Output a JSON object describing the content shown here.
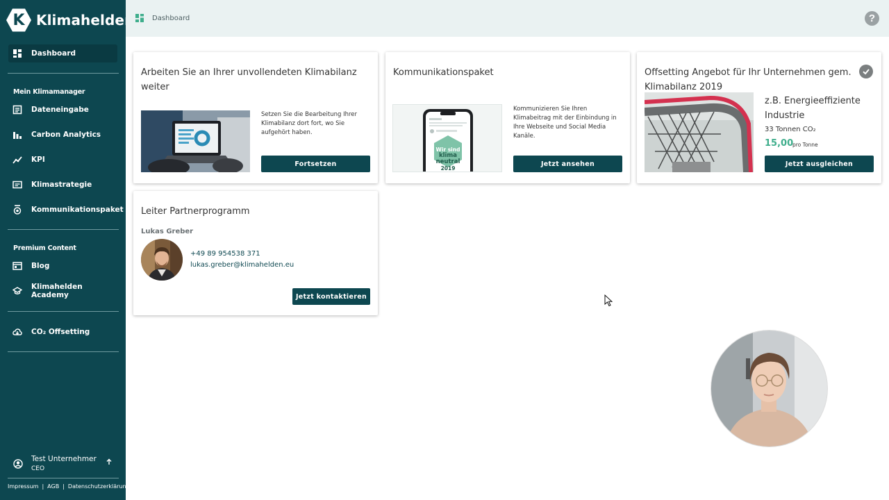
{
  "app": {
    "name": "Klimahelden",
    "logo_letter": "K"
  },
  "sidebar": {
    "active_item": "Dashboard",
    "items_top": [
      {
        "label": "Dashboard",
        "icon": "dashboard-icon"
      }
    ],
    "section1_title": "Mein Klimamanager",
    "section1_items": [
      {
        "label": "Dateneingabe",
        "icon": "data-entry-icon"
      },
      {
        "label": "Carbon Analytics",
        "icon": "bar-chart-icon"
      },
      {
        "label": "KPI",
        "icon": "trend-icon"
      },
      {
        "label": "Klimastrategie",
        "icon": "strategy-icon"
      },
      {
        "label": "Kommunikationspaket",
        "icon": "medal-icon"
      }
    ],
    "section2_title": "Premium Content",
    "section2_items": [
      {
        "label": "Blog",
        "icon": "blog-icon"
      },
      {
        "label": "Klimahelden Academy",
        "icon": "academy-icon"
      }
    ],
    "offsetting": {
      "label": "CO₂ Offsetting",
      "icon": "cloud-download-icon"
    },
    "user": {
      "name": "Test Unternehmer",
      "role": "CEO"
    },
    "footer": {
      "impressum": "Impressum",
      "agb": "AGB",
      "privacy": "Datenschutzerklärung",
      "separator": "|"
    }
  },
  "topbar": {
    "breadcrumb": "Dashboard",
    "help": "?"
  },
  "cards": {
    "continue": {
      "title": "Arbeiten Sie an Ihrer unvollendeten Klimabilanz weiter",
      "text": "Setzen Sie die Bearbeitung Ihrer Klimabilanz dort fort, wo Sie aufgehört haben.",
      "button": "Fortsetzen"
    },
    "communication": {
      "title": "Kommunikationspaket",
      "text": "Kommunizieren Sie Ihren Klimabeitrag mit der Einbindung in Ihre Webseite und Social Media Kanäle.",
      "badge_lines": [
        "Wir sind",
        "klima",
        "neutral",
        "2019"
      ],
      "button": "Jetzt ansehen"
    },
    "offsetting": {
      "title": "Offsetting Angebot für Ihr Unternehmen gem. Klimabilanz 2019",
      "offer_title": "z.B. Energieeffiziente Industrie",
      "tons": "33 Tonnen CO₂",
      "price": "15,00",
      "price_unit": "pro Tonne",
      "button": "Jetzt ausgleichen"
    },
    "partner": {
      "title": "Leiter Partnerprogramm",
      "name": "Lukas Greber",
      "phone": "+49 89 954538 371",
      "email": "lukas.greber@klimahelden.eu",
      "button": "Jetzt kontaktieren"
    }
  },
  "colors": {
    "sidebar": "#0d4750",
    "accent": "#3fae8c",
    "topbar": "#eaf2f2"
  }
}
